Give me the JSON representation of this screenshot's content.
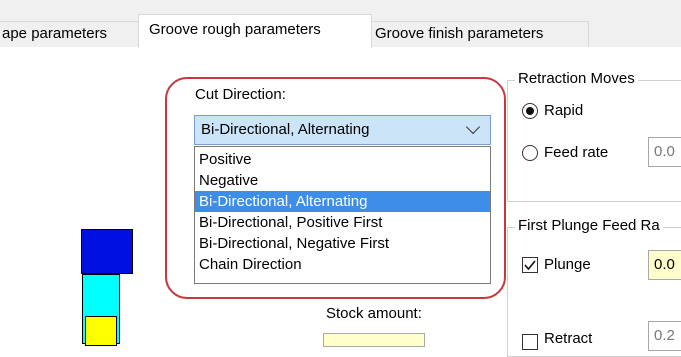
{
  "tabs": [
    {
      "label": "ape parameters"
    },
    {
      "label": "Groove rough parameters"
    },
    {
      "label": "Groove finish parameters"
    }
  ],
  "cut_direction": {
    "label": "Cut Direction:",
    "selected": "Bi-Directional, Alternating",
    "options": [
      "Positive",
      "Negative",
      "Bi-Directional, Alternating",
      "Bi-Directional, Positive First",
      "Bi-Directional, Negative First",
      "Chain Direction"
    ]
  },
  "retraction_moves": {
    "title": "Retraction Moves",
    "rapid_label": "Rapid",
    "feed_rate_label": "Feed rate",
    "feed_rate_value": "0.0"
  },
  "first_plunge": {
    "title": "First Plunge Feed Ra",
    "plunge_label": "Plunge",
    "plunge_value": "0.0",
    "retract_label": "Retract",
    "retract_value": "0.2"
  },
  "stock_amount": {
    "label": "Stock amount:"
  },
  "colors": {
    "highlight": "#c8363e",
    "combo_bg": "#cce4f7",
    "selected_option": "#3d8ee8",
    "preview_blue": "#0010e0",
    "preview_cyan": "#00ffff",
    "preview_yellow": "#ffff00"
  }
}
